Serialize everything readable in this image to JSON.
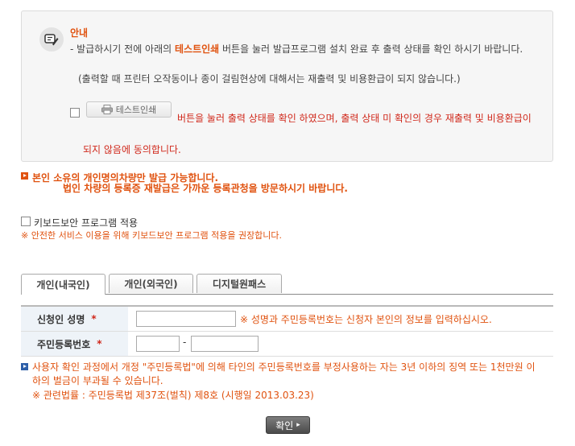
{
  "notice": {
    "title": "안내",
    "line1_prefix": "- 발급하시기 전에 아래의 ",
    "line1_highlight": "테스트인쇄",
    "line1_suffix": " 버튼을 눌러 발급프로그램 설치 완료 후 출력 상태를 확인 하시기 바랍니다.",
    "line2": "(출력할 때 프린터 오작동이나 종이 걸림현상에 대해서는 재출력 및 비용환급이 되지 않습니다.)",
    "test_print_label": "테스트인쇄",
    "agree_text": "버튼을 눌러 출력 상태를 확인 하였으며, 출력 상태 미 확인의 경우 재출력 및 비용환급이",
    "agree_text2": "되지 않음에 동의합니다."
  },
  "warning": {
    "line1": "본인 소유의 개인명의차량만 발급 가능합니다.",
    "line2": "법인 차량의 등록증 재발급은 가까운 등록관청을 방문하시기 바랍니다."
  },
  "keyboard": {
    "label": "키보드보안 프로그램 적용",
    "note": "※ 안전한 서비스 이용을 위해 키보드보안 프로그램 적용을 권장합니다."
  },
  "tabs": [
    {
      "label": "개인(내국인)"
    },
    {
      "label": "개인(외국인)"
    },
    {
      "label": "디지털원패스"
    }
  ],
  "form": {
    "name_label": "신청인 성명",
    "required_mark": "*",
    "name_hint": "※ 성명과 주민등록번호는 신청자 본인의 정보를 입력하십시오.",
    "rrn_label": "주민등록번호",
    "rrn_separator": "-"
  },
  "legal": {
    "text": "사용자 확인 과정에서 개정 \"주민등록법\"에 의해 타인의 주민등록번호를 부정사용하는 자는 3년 이하의 징역 또는 1천만원 이하의 벌금이 부과될 수 있습니다.",
    "reference": "※ 관련법률 : 주민등록법 제37조(벌칙) 제8호 (시행일 2013.03.23)"
  },
  "confirm_label": "확인",
  "colors": {
    "accent": "#e0520f",
    "alert": "#d0281b",
    "button": "#5a5a5a"
  }
}
